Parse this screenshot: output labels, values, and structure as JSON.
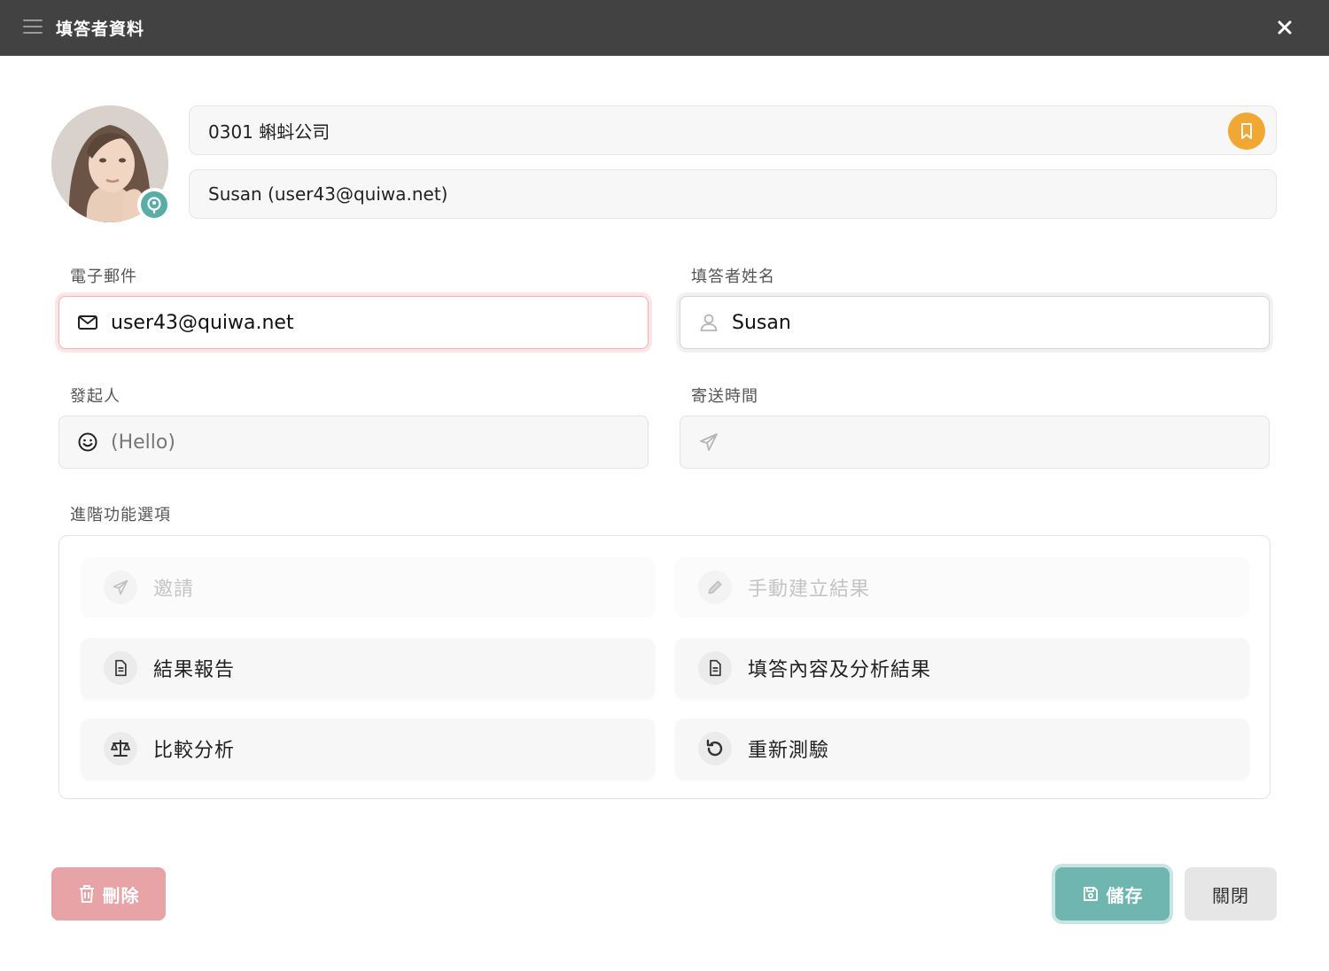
{
  "window": {
    "title": "填答者資料",
    "menu_icon": "hamburger-menu-icon",
    "close_icon": "close-icon"
  },
  "profile": {
    "avatar_icon": "user-avatar",
    "badge_icon": "quiwa-badge-icon",
    "company": "0301 蝌蚪公司",
    "user": "Susan (user43@quiwa.net)",
    "bookmark_icon": "bookmark-icon",
    "bookmark_color": "#f0a733"
  },
  "form": {
    "email": {
      "label": "電子郵件",
      "value": "user43@quiwa.net",
      "icon": "mail-icon"
    },
    "name": {
      "label": "填答者姓名",
      "value": "Susan",
      "icon": "user-icon"
    },
    "sender": {
      "label": "發起人",
      "value": "(Hello)",
      "icon": "smiley-icon"
    },
    "sent_time": {
      "label": "寄送時間",
      "value": "",
      "icon": "send-icon"
    }
  },
  "advanced": {
    "label": "進階功能選項",
    "options": [
      {
        "label": "邀請",
        "icon": "send-icon",
        "disabled": true
      },
      {
        "label": "手動建立結果",
        "icon": "pencil-icon",
        "disabled": true
      },
      {
        "label": "結果報告",
        "icon": "document-icon",
        "disabled": false
      },
      {
        "label": "填答內容及分析結果",
        "icon": "document-icon",
        "disabled": false
      },
      {
        "label": "比較分析",
        "icon": "scale-icon",
        "disabled": false
      },
      {
        "label": "重新測驗",
        "icon": "retry-icon",
        "disabled": false
      }
    ]
  },
  "footer": {
    "delete_label": "刪除",
    "save_label": "儲存",
    "close_label": "關閉",
    "delete_color": "#e8a3a6",
    "save_color": "#6fb5b0"
  }
}
